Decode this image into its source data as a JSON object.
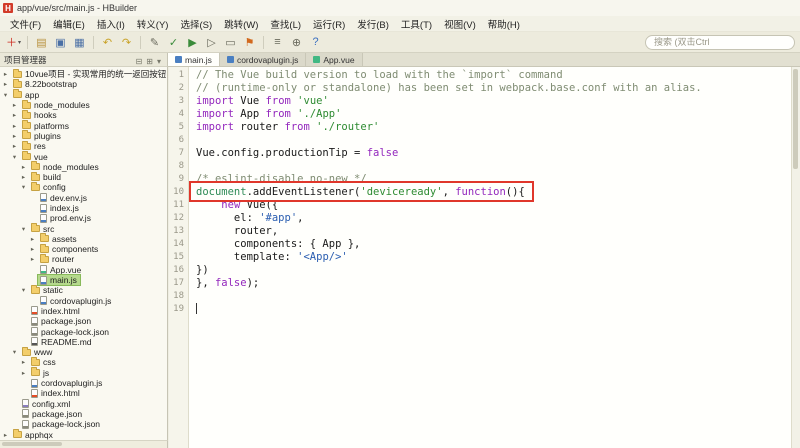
{
  "window": {
    "title": "app/vue/src/main.js - HBuilder",
    "logo_letter": "H"
  },
  "menu": {
    "items": [
      {
        "name": "file",
        "label": "文件(F)"
      },
      {
        "name": "edit",
        "label": "编辑(E)"
      },
      {
        "name": "insert",
        "label": "插入(I)"
      },
      {
        "name": "escape",
        "label": "转义(Y)"
      },
      {
        "name": "select",
        "label": "选择(S)"
      },
      {
        "name": "goto",
        "label": "跳转(W)"
      },
      {
        "name": "find",
        "label": "查找(L)"
      },
      {
        "name": "run",
        "label": "运行(R)"
      },
      {
        "name": "release",
        "label": "发行(B)"
      },
      {
        "name": "tools",
        "label": "工具(T)"
      },
      {
        "name": "view",
        "label": "视图(V)"
      },
      {
        "name": "help",
        "label": "帮助(H)"
      }
    ]
  },
  "toolbar": {
    "search_placeholder": "搜索 (双击Ctrl",
    "icons": [
      {
        "name": "new-file",
        "glyph": "＋",
        "color": "#CC2A1E",
        "dropdown": true
      },
      {
        "type": "sep"
      },
      {
        "name": "open-file",
        "glyph": "▤",
        "color": "#B8913D"
      },
      {
        "name": "save",
        "glyph": "▣",
        "color": "#4A6FA5"
      },
      {
        "name": "save-all",
        "glyph": "▦",
        "color": "#4A6FA5"
      },
      {
        "type": "sep"
      },
      {
        "name": "undo",
        "glyph": "↶",
        "color": "#C9A227"
      },
      {
        "name": "redo",
        "glyph": "↷",
        "color": "#C9A227"
      },
      {
        "type": "sep"
      },
      {
        "name": "edit-mode",
        "glyph": "✎",
        "color": "#6B6B5E"
      },
      {
        "name": "validate",
        "glyph": "✓",
        "color": "#3A8B3A"
      },
      {
        "name": "run",
        "glyph": "▶",
        "color": "#3A8B3A"
      },
      {
        "name": "debug",
        "glyph": "▷",
        "color": "#6B6B5E"
      },
      {
        "name": "device",
        "glyph": "▭",
        "color": "#6B6B5E"
      },
      {
        "name": "publish",
        "glyph": "⚑",
        "color": "#D2691E"
      },
      {
        "type": "sep"
      },
      {
        "name": "format",
        "glyph": "≡",
        "color": "#6B6B5E"
      },
      {
        "name": "plugins",
        "glyph": "⊕",
        "color": "#6B6B5E"
      },
      {
        "name": "help",
        "glyph": "?",
        "color": "#3A6FC0"
      }
    ]
  },
  "panel": {
    "title": "项目管理器",
    "icons": [
      {
        "name": "collapse-all",
        "glyph": "⊟"
      },
      {
        "name": "locate-file",
        "glyph": "⊞"
      },
      {
        "name": "panel-menu",
        "glyph": "▾"
      }
    ]
  },
  "tabs": [
    {
      "name": "main-js",
      "label": "main.js",
      "icon": "js",
      "active": true
    },
    {
      "name": "cordovaplugin-js",
      "label": "cordovaplugin.js",
      "icon": "js",
      "active": false
    },
    {
      "name": "app-vue",
      "label": "App.vue",
      "icon": "vue",
      "active": false
    }
  ],
  "tree": {
    "selected_bg": "#B5D98C",
    "selected_border": "#88B95A",
    "items": [
      {
        "label": "10vue项目 - 实现常用的统一返回按钮",
        "depth": 0,
        "icon": "folder",
        "arrow": "c"
      },
      {
        "label": "8.22bootstrap",
        "depth": 0,
        "icon": "folder",
        "arrow": "c"
      },
      {
        "label": "app",
        "depth": 0,
        "icon": "folder",
        "arrow": "e"
      },
      {
        "label": "node_modules",
        "depth": 1,
        "icon": "folder",
        "arrow": "c"
      },
      {
        "label": "hooks",
        "depth": 1,
        "icon": "folder",
        "arrow": "c"
      },
      {
        "label": "platforms",
        "depth": 1,
        "icon": "folder",
        "arrow": "c"
      },
      {
        "label": "plugins",
        "depth": 1,
        "icon": "folder",
        "arrow": "c"
      },
      {
        "label": "res",
        "depth": 1,
        "icon": "folder",
        "arrow": "c"
      },
      {
        "label": "vue",
        "depth": 1,
        "icon": "folder",
        "arrow": "e"
      },
      {
        "label": "node_modules",
        "depth": 2,
        "icon": "folder",
        "arrow": "c"
      },
      {
        "label": "build",
        "depth": 2,
        "icon": "folder",
        "arrow": "c"
      },
      {
        "label": "config",
        "depth": 2,
        "icon": "folder",
        "arrow": "e"
      },
      {
        "label": "dev.env.js",
        "depth": 3,
        "icon": "js",
        "arrow": "n"
      },
      {
        "label": "index.js",
        "depth": 3,
        "icon": "js",
        "arrow": "n"
      },
      {
        "label": "prod.env.js",
        "depth": 3,
        "icon": "js",
        "arrow": "n"
      },
      {
        "label": "src",
        "depth": 2,
        "icon": "folder",
        "arrow": "e"
      },
      {
        "label": "assets",
        "depth": 3,
        "icon": "folder",
        "arrow": "c"
      },
      {
        "label": "components",
        "depth": 3,
        "icon": "folder",
        "arrow": "c"
      },
      {
        "label": "router",
        "depth": 3,
        "icon": "folder",
        "arrow": "c"
      },
      {
        "label": "App.vue",
        "depth": 3,
        "icon": "vue",
        "arrow": "n"
      },
      {
        "label": "main.js",
        "depth": 3,
        "icon": "js",
        "arrow": "n",
        "selected": true
      },
      {
        "label": "static",
        "depth": 2,
        "icon": "folder",
        "arrow": "e"
      },
      {
        "label": "cordovaplugin.js",
        "depth": 3,
        "icon": "js",
        "arrow": "n"
      },
      {
        "label": "index.html",
        "depth": 2,
        "icon": "html",
        "arrow": "n"
      },
      {
        "label": "package.json",
        "depth": 2,
        "icon": "json",
        "arrow": "n"
      },
      {
        "label": "package-lock.json",
        "depth": 2,
        "icon": "json",
        "arrow": "n"
      },
      {
        "label": "README.md",
        "depth": 2,
        "icon": "md",
        "arrow": "n"
      },
      {
        "label": "www",
        "depth": 1,
        "icon": "folder",
        "arrow": "e"
      },
      {
        "label": "css",
        "depth": 2,
        "icon": "folder",
        "arrow": "c"
      },
      {
        "label": "js",
        "depth": 2,
        "icon": "folder",
        "arrow": "c"
      },
      {
        "label": "cordovaplugin.js",
        "depth": 2,
        "icon": "js",
        "arrow": "n"
      },
      {
        "label": "index.html",
        "depth": 2,
        "icon": "html",
        "arrow": "n"
      },
      {
        "label": "config.xml",
        "depth": 1,
        "icon": "xml",
        "arrow": "n"
      },
      {
        "label": "package.json",
        "depth": 1,
        "icon": "json",
        "arrow": "n"
      },
      {
        "label": "package-lock.json",
        "depth": 1,
        "icon": "json",
        "arrow": "n"
      },
      {
        "label": "apphqx",
        "depth": 0,
        "icon": "folder",
        "arrow": "c"
      }
    ]
  },
  "editor": {
    "colors": {
      "cm": "#7F8C72",
      "kw": "#9327BD",
      "st": "#2E8B32",
      "st2": "#2A5DB0",
      "bi": "#2E8B57",
      "pl": "#1A1A1A"
    },
    "lines": [
      {
        "n": "1",
        "segs": [
          [
            "// The Vue build version to load with the `import` command",
            "cm"
          ]
        ]
      },
      {
        "n": "2",
        "segs": [
          [
            "// (runtime-only or standalone) has been set in webpack.base.conf with an alias.",
            "cm"
          ]
        ]
      },
      {
        "n": "3",
        "segs": [
          [
            "import",
            "kw"
          ],
          [
            " Vue ",
            "pl"
          ],
          [
            "from",
            "kw"
          ],
          [
            " ",
            "pl"
          ],
          [
            "'vue'",
            "st"
          ]
        ]
      },
      {
        "n": "4",
        "segs": [
          [
            "import",
            "kw"
          ],
          [
            " App ",
            "pl"
          ],
          [
            "from",
            "kw"
          ],
          [
            " ",
            "pl"
          ],
          [
            "'./App'",
            "st"
          ]
        ]
      },
      {
        "n": "5",
        "segs": [
          [
            "import",
            "kw"
          ],
          [
            " router ",
            "pl"
          ],
          [
            "from",
            "kw"
          ],
          [
            " ",
            "pl"
          ],
          [
            "'./router'",
            "st"
          ]
        ]
      },
      {
        "n": "6",
        "segs": []
      },
      {
        "n": "7",
        "segs": [
          [
            "Vue.config.productionTip = ",
            "pl"
          ],
          [
            "false",
            "kw"
          ]
        ]
      },
      {
        "n": "8",
        "segs": []
      },
      {
        "n": "9",
        "segs": [
          [
            "/* eslint-disable no-new */",
            "cm"
          ]
        ]
      },
      {
        "n": "10",
        "segs": [
          [
            "document",
            "bi"
          ],
          [
            ".addEventListener(",
            "pl"
          ],
          [
            "'deviceready'",
            "st"
          ],
          [
            ", ",
            "pl"
          ],
          [
            "function",
            "kw"
          ],
          [
            "(){",
            "pl"
          ]
        ]
      },
      {
        "n": "11",
        "segs": [
          [
            "    ",
            "pl"
          ],
          [
            "new",
            "kw"
          ],
          [
            " Vue({",
            "pl"
          ]
        ]
      },
      {
        "n": "12",
        "segs": [
          [
            "      el: ",
            "pl"
          ],
          [
            "'#app'",
            "st2"
          ],
          [
            ",",
            "pl"
          ]
        ]
      },
      {
        "n": "13",
        "segs": [
          [
            "      router,",
            "pl"
          ]
        ]
      },
      {
        "n": "14",
        "segs": [
          [
            "      components: { App },",
            "pl"
          ]
        ]
      },
      {
        "n": "15",
        "segs": [
          [
            "      template: ",
            "pl"
          ],
          [
            "'<App/>'",
            "st2"
          ]
        ]
      },
      {
        "n": "16",
        "segs": [
          [
            "})",
            "pl"
          ]
        ]
      },
      {
        "n": "17",
        "segs": [
          [
            "}, ",
            "pl"
          ],
          [
            "false",
            "kw"
          ],
          [
            ");",
            "pl"
          ]
        ]
      },
      {
        "n": "18",
        "segs": []
      },
      {
        "n": "19",
        "segs": []
      }
    ]
  },
  "annotation": {
    "box_color": "#E0372B"
  }
}
